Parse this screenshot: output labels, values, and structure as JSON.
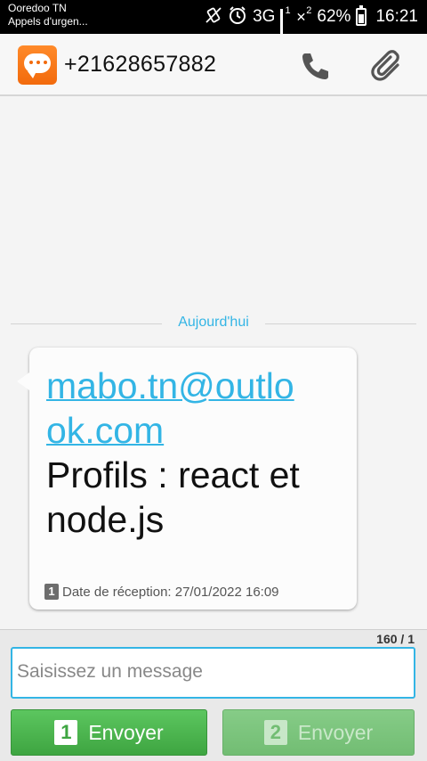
{
  "status_bar": {
    "carrier": "Ooredoo TN",
    "carrier_sub": "Appels d'urgen...",
    "network": "3G",
    "sim1_label": "1",
    "sim2_label": "2",
    "battery": "62%",
    "battery_level": 0.62,
    "time": "16:21"
  },
  "header": {
    "contact": "+21628657882",
    "icons": [
      "messages-app-icon",
      "phone-icon",
      "attach-icon"
    ]
  },
  "conversation": {
    "date_separator": "Aujourd'hui",
    "message": {
      "link_line1": "mabo.tn@outlo",
      "link_line2": "ok.com",
      "text_line1": "Profils : react et",
      "text_line2": "node.js",
      "sim_badge": "1",
      "received": "Date de réception: 27/01/2022 16:09"
    }
  },
  "compose": {
    "counter": "160 / 1",
    "placeholder": "Saisissez un message",
    "send1": {
      "sim": "1",
      "label": "Envoyer"
    },
    "send2": {
      "sim": "2",
      "label": "Envoyer"
    }
  },
  "colors": {
    "accent": "#33b5e5",
    "send_green": "#3ea541",
    "app_orange": "#f26a0c"
  }
}
